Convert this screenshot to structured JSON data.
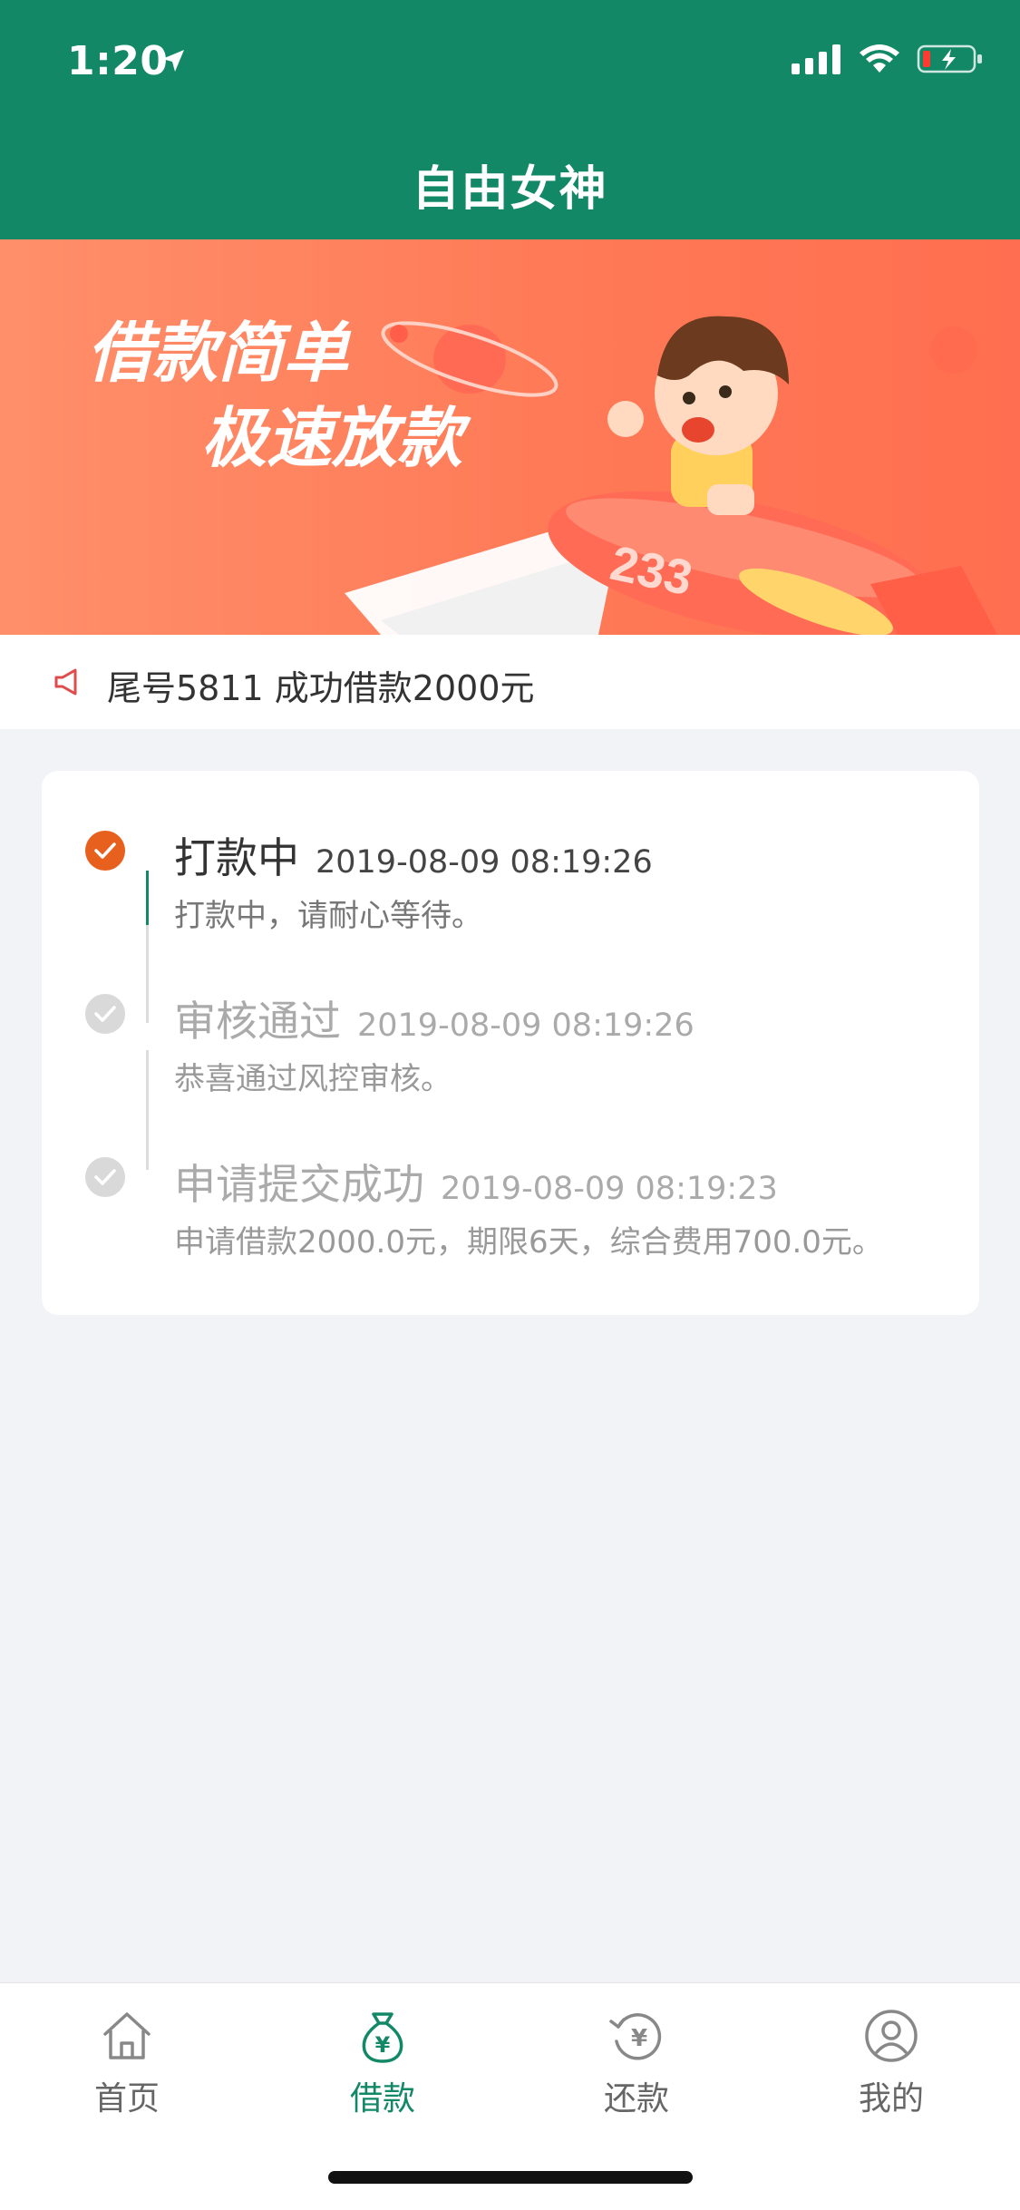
{
  "status_bar": {
    "time": "1:20"
  },
  "header": {
    "title": "自由女神"
  },
  "banner": {
    "line1": "借款简单",
    "line2": "极速放款",
    "rocket_number": "233"
  },
  "notice": {
    "text": "尾号5811 成功借款2000元"
  },
  "timeline": [
    {
      "title": "打款中",
      "time": "2019-08-09 08:19:26",
      "desc": "打款中，请耐心等待。",
      "active": true
    },
    {
      "title": "审核通过",
      "time": "2019-08-09 08:19:26",
      "desc": "恭喜通过风控审核。",
      "active": false
    },
    {
      "title": "申请提交成功",
      "time": "2019-08-09 08:19:23",
      "desc": "申请借款2000.0元，期限6天，综合费用700.0元。",
      "active": false
    }
  ],
  "tabbar": {
    "items": [
      {
        "label": "首页",
        "icon": "home-icon",
        "active": false
      },
      {
        "label": "借款",
        "icon": "money-bag-icon",
        "active": true
      },
      {
        "label": "还款",
        "icon": "repay-icon",
        "active": false
      },
      {
        "label": "我的",
        "icon": "profile-icon",
        "active": false
      }
    ]
  },
  "colors": {
    "brand": "#138867",
    "active_step": "#e8601d",
    "inactive_step": "#d8d8d8",
    "banner": "#ff7a57"
  }
}
